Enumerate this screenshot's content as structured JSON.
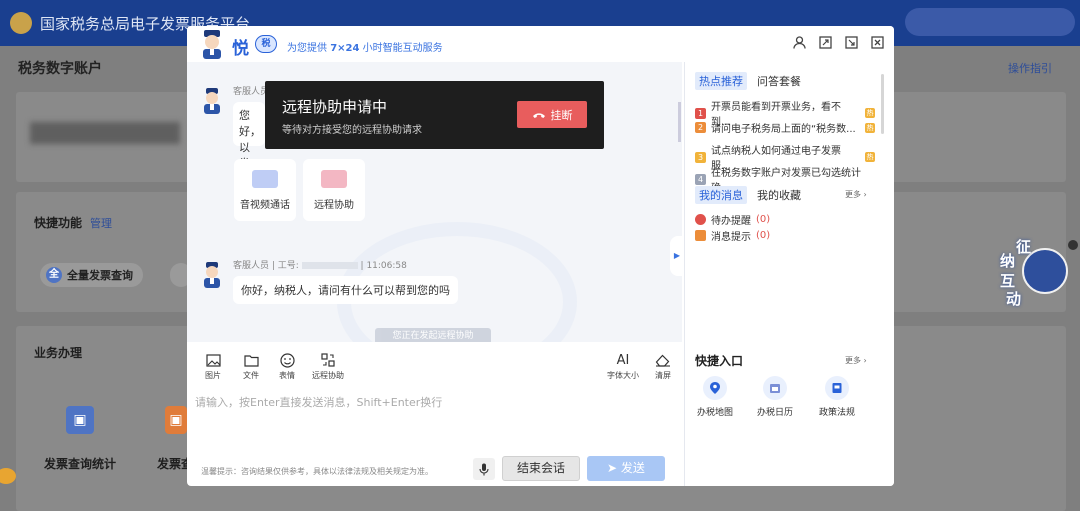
{
  "background": {
    "site_title": "国家税务总局电子发票服务平台",
    "account_title": "税务数字账户",
    "guide_link": "操作指引",
    "quick_functions_label": "快捷功能",
    "manage_link": "管理",
    "invoice_query_chip": "全量发票查询",
    "business_label": "业务办理",
    "invoice_stats_label": "发票查询统计",
    "invoice_second_label": "发票查",
    "float_help_chars": [
      "征",
      "纳",
      "互",
      "动"
    ]
  },
  "dialog": {
    "brand": "悦",
    "brand_badge": "税",
    "slogan_prefix": "为您提供",
    "slogan_bold": "7×24",
    "slogan_suffix": "小时智能互动服务",
    "chat": {
      "msg1_meta": "客服人员",
      "msg1_text_line1": "您好，",
      "msg1_text_line2": "以发起",
      "card_video_label": "音视频通话",
      "card_remote_label": "远程协助",
      "msg2_meta": "客服人员 | 工号:",
      "msg2_time": "| 11:06:58",
      "msg2_text": "你好，纳税人，请问有什么可以帮到您的吗",
      "system_note": "您正在发起远程协助"
    },
    "toolbar": {
      "image_label": "图片",
      "file_label": "文件",
      "emoji_label": "表情",
      "remote_label": "远程协助",
      "font_size_icon_text": "AI",
      "font_size_label": "字体大小",
      "clear_label": "清屏"
    },
    "input": {
      "placeholder": "请输入，按Enter直接发送消息，Shift+Enter换行"
    },
    "footer": {
      "tip": "温馨提示：咨询结果仅供参考，具体以法律法规及相关规定为准。",
      "end_label": "结束会话",
      "send_label": "发送"
    },
    "right_panel": {
      "tab_hot": "热点推荐",
      "tab_qa": "问答套餐",
      "hot_items": [
        {
          "num": "1",
          "text": "开票员能看到开票业务，看不到...",
          "badge": "热",
          "color": "#e0514b"
        },
        {
          "num": "2",
          "text": "请问电子税务局上面的“税务数...",
          "badge": "热",
          "color": "#ec8d3a"
        },
        {
          "num": "3",
          "text": "试点纳税人如何通过电子发票服...",
          "badge": "热",
          "color": "#f1b33a"
        },
        {
          "num": "4",
          "text": "在税务数字账户对发票已勾选统计确...",
          "badge": "",
          "color": "#9aa3b5"
        }
      ],
      "tab_msgs": "我的消息",
      "tab_fav": "我的收藏",
      "more_label": "更多 ›",
      "msg_items": [
        {
          "label": "待办提醒",
          "count": "(0)",
          "color": "#e0514b"
        },
        {
          "label": "消息提示",
          "count": "(0)",
          "color": "#ec8d3a"
        }
      ],
      "quick_title": "快捷入口",
      "quick_more": "更多 ›",
      "quick_items": [
        {
          "label": "办税地图",
          "icon": "map-pin-icon"
        },
        {
          "label": "办税日历",
          "icon": "calendar-icon"
        },
        {
          "label": "政策法规",
          "icon": "document-icon"
        }
      ]
    }
  },
  "remote_overlay": {
    "title": "远程协助申请中",
    "subtitle": "等待对方接受您的远程协助请求",
    "hangup_label": "挂断"
  },
  "colors": {
    "accent": "#2a62d8",
    "hangup": "#e85d5d",
    "send_disabled": "#a9c7f5"
  }
}
